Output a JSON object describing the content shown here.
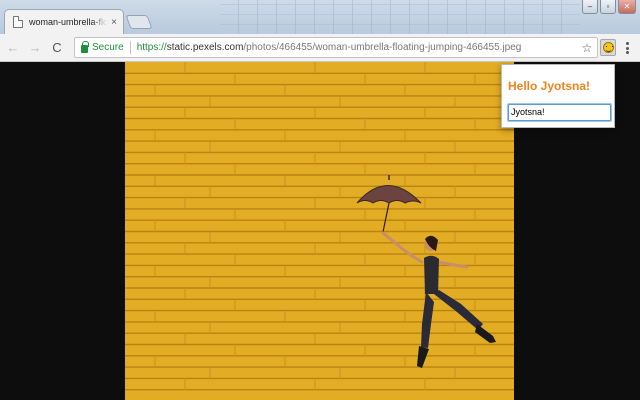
{
  "browser": {
    "tab": {
      "title": "woman-umbrella-floatin",
      "close_glyph": "×",
      "favicon": "document-icon"
    },
    "window_controls": {
      "minimize": "–",
      "maximize": "▫",
      "close": "✕"
    },
    "nav": {
      "back": "←",
      "forward": "→",
      "reload": "C",
      "home": "⌂"
    },
    "omnibox": {
      "secure_label": "Secure",
      "url_scheme": "https://",
      "url_host": "static.pexels.com",
      "url_path": "/photos/466455/woman-umbrella-floating-jumping-466455.jpeg"
    },
    "bookmark_glyph": "☆",
    "extension_icon": "smiley-icon",
    "menu_icon": "vertical-dots-icon"
  },
  "popup": {
    "heading": "Hello Jyotsna!",
    "name_input_value": "Jyotsna!"
  },
  "colors": {
    "accent_orange": "#f0841c",
    "secure_green": "#1e8e3e",
    "wall_yellow": "#e2ac24",
    "letterbox": "#0d0d0d"
  }
}
